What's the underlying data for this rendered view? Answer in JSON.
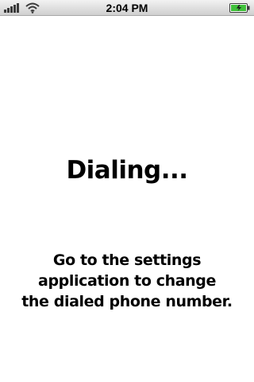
{
  "status_bar": {
    "time": "2:04 PM",
    "signal_icon": "cellular-signal-icon",
    "wifi_icon": "wifi-icon",
    "battery_icon": "battery-charging-icon",
    "battery_fill_color": "#3fc03a"
  },
  "main": {
    "title": "Dialing...",
    "message_lines": [
      "Go to the settings",
      "application to change",
      "the dialed phone number."
    ]
  }
}
